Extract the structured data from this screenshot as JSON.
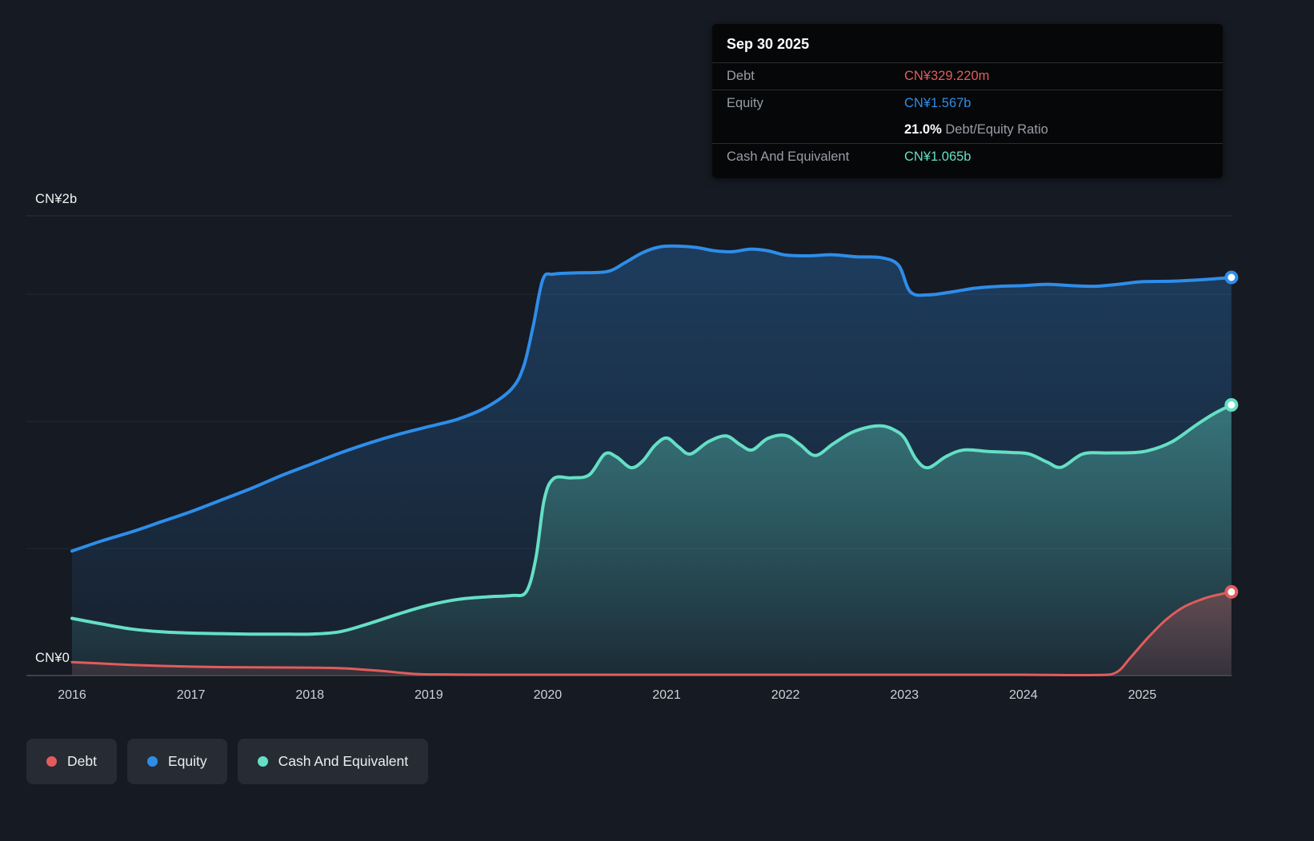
{
  "tooltip": {
    "date": "Sep 30 2025",
    "debt_label": "Debt",
    "debt_value": "CN¥329.220m",
    "equity_label": "Equity",
    "equity_value": "CN¥1.567b",
    "ratio_value": "21.0%",
    "ratio_label": "Debt/Equity Ratio",
    "cash_label": "Cash And Equivalent",
    "cash_value": "CN¥1.065b"
  },
  "chart_data": {
    "type": "area",
    "y_axis": {
      "top_label": "CN¥2b",
      "bottom_label": "CN¥0",
      "unit": "CN¥ billions"
    },
    "ylim": [
      0,
      2
    ],
    "xlim": [
      2016,
      2025.75
    ],
    "x_ticks": [
      2016,
      2017,
      2018,
      2019,
      2020,
      2021,
      2022,
      2023,
      2024,
      2025
    ],
    "gridlines_b": [
      0.5,
      1.0,
      1.5
    ],
    "legend_position": "bottom-left",
    "series": [
      {
        "name": "Debt",
        "color": "#e25c5c",
        "final_label": "CN¥329.220m",
        "points": [
          [
            2016,
            0.053
          ],
          [
            2016.5,
            0.042
          ],
          [
            2017,
            0.035
          ],
          [
            2017.5,
            0.032
          ],
          [
            2018,
            0.031
          ],
          [
            2018.3,
            0.028
          ],
          [
            2018.6,
            0.018
          ],
          [
            2018.9,
            0.006
          ],
          [
            2019.2,
            0.004
          ],
          [
            2019.5,
            0.003
          ],
          [
            2020,
            0.003
          ],
          [
            2020.5,
            0.003
          ],
          [
            2021,
            0.003
          ],
          [
            2021.5,
            0.003
          ],
          [
            2022,
            0.003
          ],
          [
            2022.5,
            0.003
          ],
          [
            2023,
            0.003
          ],
          [
            2023.5,
            0.003
          ],
          [
            2024,
            0.003
          ],
          [
            2024.6,
            0.002
          ],
          [
            2024.78,
            0.012
          ],
          [
            2024.9,
            0.07
          ],
          [
            2025.05,
            0.15
          ],
          [
            2025.2,
            0.22
          ],
          [
            2025.35,
            0.27
          ],
          [
            2025.5,
            0.3
          ],
          [
            2025.6,
            0.314
          ],
          [
            2025.75,
            0.329
          ]
        ]
      },
      {
        "name": "Equity",
        "color": "#2e8de9",
        "final_label": "CN¥1.567b",
        "points": [
          [
            2016,
            0.49
          ],
          [
            2016.25,
            0.53
          ],
          [
            2016.5,
            0.565
          ],
          [
            2016.75,
            0.605
          ],
          [
            2017,
            0.645
          ],
          [
            2017.25,
            0.69
          ],
          [
            2017.5,
            0.735
          ],
          [
            2017.75,
            0.785
          ],
          [
            2018,
            0.83
          ],
          [
            2018.25,
            0.875
          ],
          [
            2018.5,
            0.915
          ],
          [
            2018.75,
            0.95
          ],
          [
            2019,
            0.98
          ],
          [
            2019.25,
            1.01
          ],
          [
            2019.5,
            1.06
          ],
          [
            2019.7,
            1.13
          ],
          [
            2019.8,
            1.22
          ],
          [
            2019.88,
            1.38
          ],
          [
            2019.96,
            1.56
          ],
          [
            2020.05,
            1.58
          ],
          [
            2020.25,
            1.585
          ],
          [
            2020.5,
            1.59
          ],
          [
            2020.65,
            1.625
          ],
          [
            2020.8,
            1.665
          ],
          [
            2020.95,
            1.688
          ],
          [
            2021.1,
            1.69
          ],
          [
            2021.25,
            1.685
          ],
          [
            2021.4,
            1.672
          ],
          [
            2021.55,
            1.668
          ],
          [
            2021.7,
            1.678
          ],
          [
            2021.85,
            1.672
          ],
          [
            2022,
            1.655
          ],
          [
            2022.2,
            1.652
          ],
          [
            2022.4,
            1.656
          ],
          [
            2022.6,
            1.648
          ],
          [
            2022.8,
            1.645
          ],
          [
            2022.95,
            1.615
          ],
          [
            2023.05,
            1.51
          ],
          [
            2023.2,
            1.498
          ],
          [
            2023.4,
            1.51
          ],
          [
            2023.6,
            1.525
          ],
          [
            2023.8,
            1.532
          ],
          [
            2024,
            1.535
          ],
          [
            2024.2,
            1.54
          ],
          [
            2024.4,
            1.535
          ],
          [
            2024.6,
            1.532
          ],
          [
            2024.8,
            1.54
          ],
          [
            2025,
            1.55
          ],
          [
            2025.25,
            1.552
          ],
          [
            2025.5,
            1.558
          ],
          [
            2025.75,
            1.567
          ]
        ]
      },
      {
        "name": "Cash And Equivalent",
        "color": "#65dfc5",
        "final_label": "CN¥1.065b",
        "points": [
          [
            2016,
            0.225
          ],
          [
            2016.25,
            0.203
          ],
          [
            2016.5,
            0.183
          ],
          [
            2016.75,
            0.172
          ],
          [
            2017,
            0.167
          ],
          [
            2017.25,
            0.165
          ],
          [
            2017.5,
            0.163
          ],
          [
            2017.75,
            0.163
          ],
          [
            2018,
            0.163
          ],
          [
            2018.25,
            0.172
          ],
          [
            2018.5,
            0.205
          ],
          [
            2018.75,
            0.243
          ],
          [
            2019,
            0.277
          ],
          [
            2019.25,
            0.3
          ],
          [
            2019.5,
            0.31
          ],
          [
            2019.7,
            0.315
          ],
          [
            2019.82,
            0.33
          ],
          [
            2019.9,
            0.46
          ],
          [
            2019.97,
            0.69
          ],
          [
            2020.05,
            0.775
          ],
          [
            2020.2,
            0.778
          ],
          [
            2020.35,
            0.79
          ],
          [
            2020.48,
            0.872
          ],
          [
            2020.58,
            0.86
          ],
          [
            2020.7,
            0.818
          ],
          [
            2020.8,
            0.845
          ],
          [
            2020.9,
            0.905
          ],
          [
            2021,
            0.935
          ],
          [
            2021.1,
            0.9
          ],
          [
            2021.2,
            0.872
          ],
          [
            2021.35,
            0.92
          ],
          [
            2021.5,
            0.943
          ],
          [
            2021.62,
            0.908
          ],
          [
            2021.72,
            0.888
          ],
          [
            2021.85,
            0.933
          ],
          [
            2022,
            0.945
          ],
          [
            2022.12,
            0.91
          ],
          [
            2022.25,
            0.866
          ],
          [
            2022.4,
            0.912
          ],
          [
            2022.55,
            0.955
          ],
          [
            2022.7,
            0.978
          ],
          [
            2022.82,
            0.982
          ],
          [
            2022.92,
            0.965
          ],
          [
            2023,
            0.935
          ],
          [
            2023.1,
            0.85
          ],
          [
            2023.2,
            0.818
          ],
          [
            2023.35,
            0.862
          ],
          [
            2023.5,
            0.888
          ],
          [
            2023.7,
            0.882
          ],
          [
            2023.9,
            0.878
          ],
          [
            2024.05,
            0.872
          ],
          [
            2024.2,
            0.84
          ],
          [
            2024.32,
            0.82
          ],
          [
            2024.5,
            0.872
          ],
          [
            2024.7,
            0.876
          ],
          [
            2024.9,
            0.877
          ],
          [
            2025.05,
            0.885
          ],
          [
            2025.25,
            0.92
          ],
          [
            2025.45,
            0.985
          ],
          [
            2025.6,
            1.03
          ],
          [
            2025.75,
            1.065
          ]
        ]
      }
    ]
  }
}
